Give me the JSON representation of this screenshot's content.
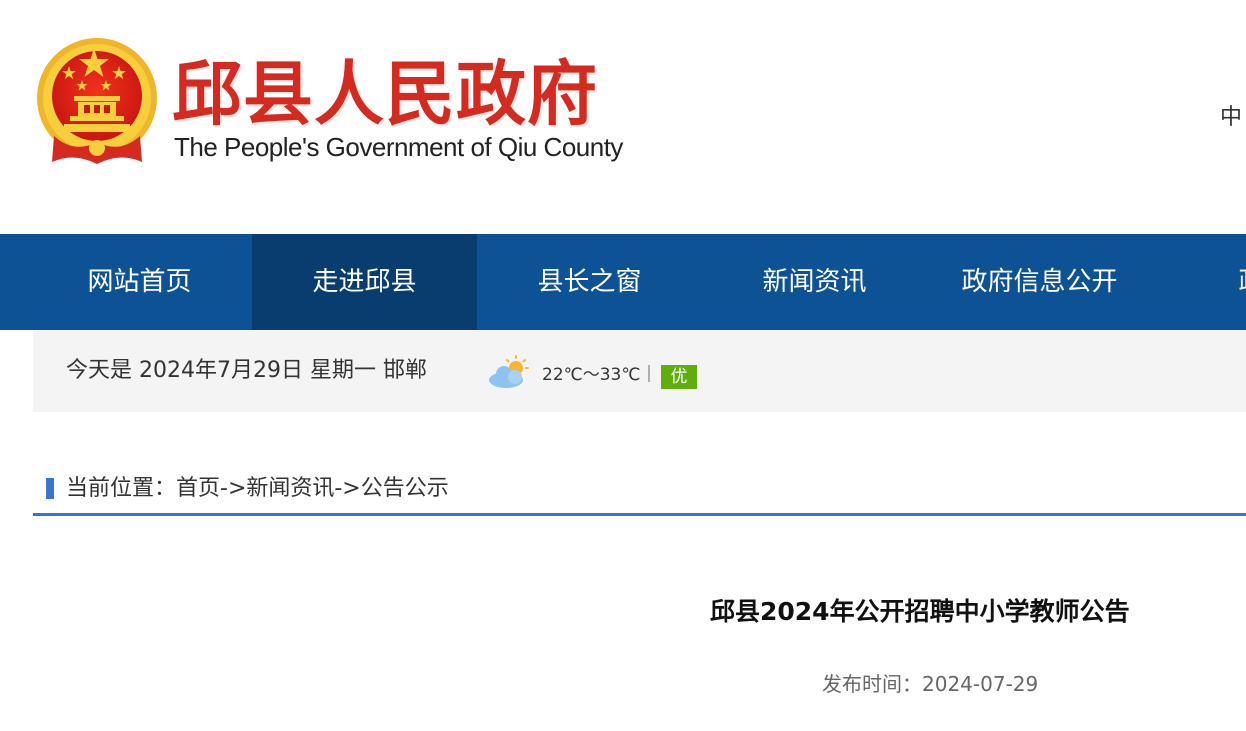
{
  "header": {
    "title": "邱县人民政府",
    "subtitle": "The People's Government of Qiu County",
    "lang_switch": "中"
  },
  "nav": {
    "items": [
      {
        "label": "网站首页",
        "active": false
      },
      {
        "label": "走进邱县",
        "active": true
      },
      {
        "label": "县长之窗",
        "active": false
      },
      {
        "label": "新闻资讯",
        "active": false
      },
      {
        "label": "政府信息公开",
        "active": false
      },
      {
        "label": "政务",
        "active": false
      }
    ],
    "colors": {
      "bar": "#0e5296",
      "active": "#093d70"
    }
  },
  "info_bar": {
    "date_text": "今天是 2024年7月29日 星期一 邯郸",
    "weather_icon": "partly-cloudy-icon",
    "temperature": "22℃～33℃｜",
    "air_quality": "优",
    "air_quality_color": "#5fae0c"
  },
  "breadcrumb": {
    "text": "当前位置：首页->新闻资讯->公告公示",
    "accent_color": "#3d74c9"
  },
  "article": {
    "title": "邱县2024年公开招聘中小学教师公告",
    "publish_label": "发布时间：",
    "publish_date": "2024-07-29"
  }
}
